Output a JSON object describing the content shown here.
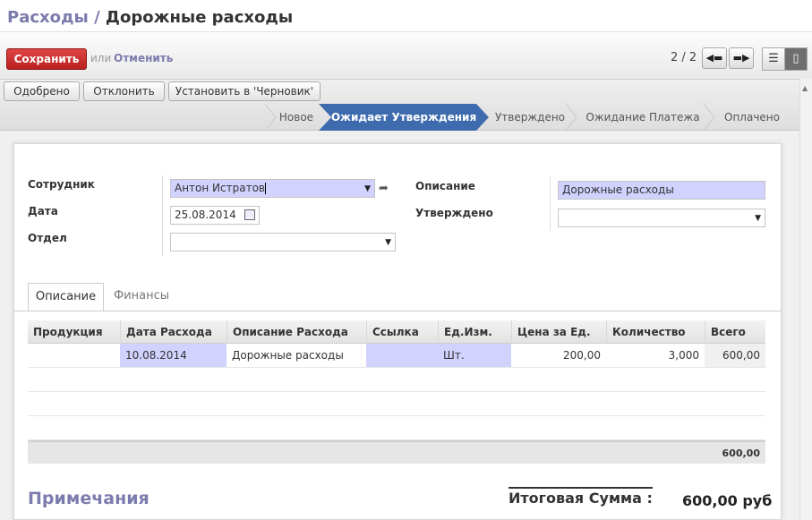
{
  "breadcrumb": {
    "parent": "Расходы",
    "separator": " / ",
    "current": "Дорожные расходы"
  },
  "toolbar": {
    "save_label": "Сохранить",
    "or_text": "или",
    "cancel_label": "Отменить",
    "pager_text": "2 / 2",
    "prev_icon": "arrow-left-icon",
    "next_icon": "arrow-right-icon"
  },
  "workflow": {
    "buttons": [
      "Одобрено",
      "Отклонить",
      "Установить в 'Черновик'"
    ],
    "stages": [
      "Новое",
      "Ожидает Утверждения",
      "Утверждено",
      "Ожидание Платежа",
      "Оплачено"
    ],
    "active_stage": "Ожидает Утверждения"
  },
  "form": {
    "employee_label": "Сотрудник",
    "employee_value": "Антон Истратов",
    "date_label": "Дата",
    "date_value": "25.08.2014",
    "department_label": "Отдел",
    "department_value": "",
    "description_label": "Описание",
    "description_value": "Дорожные расходы",
    "approved_label": "Утверждено",
    "approved_value": ""
  },
  "tabs": [
    "Описание",
    "Финансы"
  ],
  "table": {
    "headers": [
      "Продукция",
      "Дата Расхода",
      "Описание Расхода",
      "Ссылка",
      "Ед.Изм.",
      "Цена за Ед.",
      "Количество",
      "Всего"
    ],
    "rows": [
      [
        "",
        "10.08.2014",
        "Дорожные расходы",
        "",
        "Шт.",
        "200,00",
        "3,000",
        "600,00"
      ]
    ],
    "footer_total": "600,00"
  },
  "summary": {
    "notes_title": "Примечания",
    "total_label": "Итоговая Сумма :",
    "total_value": "600,00 руб"
  },
  "colors": {
    "accent": "#7c7bad",
    "save": "#c42a2a",
    "stage_active": "#3e6bae",
    "required_bg": "#d2d2ff"
  }
}
